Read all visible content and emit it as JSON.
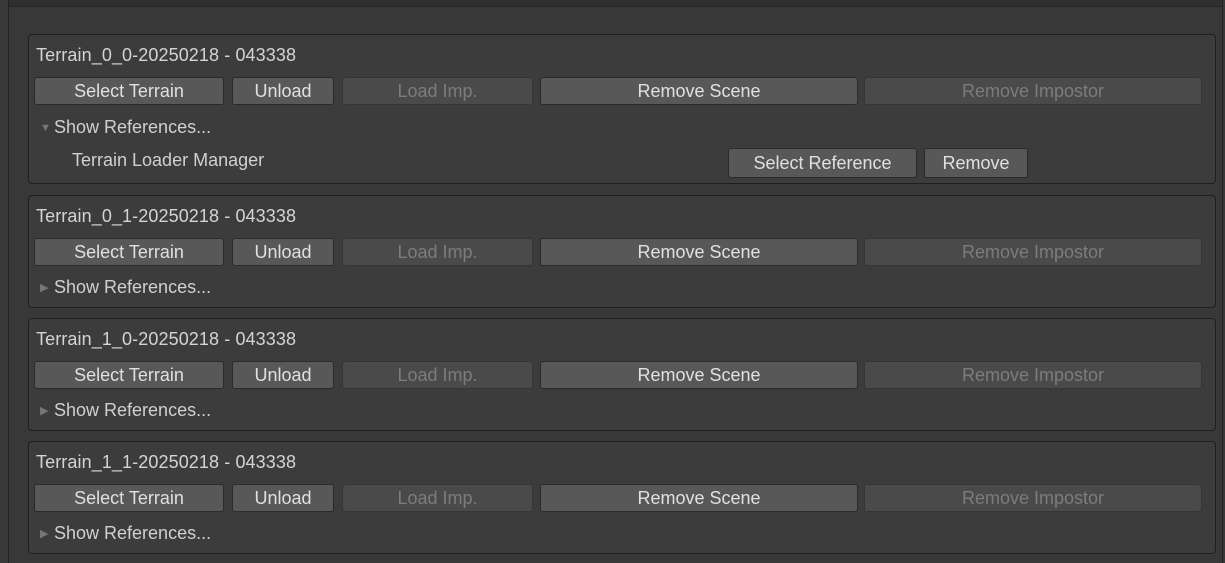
{
  "panels": [
    {
      "title": "Terrain_0_0-20250218 - 043338",
      "buttons": {
        "select_terrain": "Select Terrain",
        "unload": "Unload",
        "load_imp": "Load Imp.",
        "remove_scene": "Remove Scene",
        "remove_impostor": "Remove Impostor"
      },
      "foldout": {
        "label": "Show References...",
        "expanded": true,
        "icon": "triangle-down-icon"
      },
      "references": [
        {
          "name": "Terrain Loader Manager",
          "select_label": "Select Reference",
          "remove_label": "Remove"
        }
      ]
    },
    {
      "title": "Terrain_0_1-20250218 - 043338",
      "buttons": {
        "select_terrain": "Select Terrain",
        "unload": "Unload",
        "load_imp": "Load Imp.",
        "remove_scene": "Remove Scene",
        "remove_impostor": "Remove Impostor"
      },
      "foldout": {
        "label": "Show References...",
        "expanded": false,
        "icon": "triangle-right-icon"
      }
    },
    {
      "title": "Terrain_1_0-20250218 - 043338",
      "buttons": {
        "select_terrain": "Select Terrain",
        "unload": "Unload",
        "load_imp": "Load Imp.",
        "remove_scene": "Remove Scene",
        "remove_impostor": "Remove Impostor"
      },
      "foldout": {
        "label": "Show References...",
        "expanded": false,
        "icon": "triangle-right-icon"
      }
    },
    {
      "title": "Terrain_1_1-20250218 - 043338",
      "buttons": {
        "select_terrain": "Select Terrain",
        "unload": "Unload",
        "load_imp": "Load Imp.",
        "remove_scene": "Remove Scene",
        "remove_impostor": "Remove Impostor"
      },
      "foldout": {
        "label": "Show References...",
        "expanded": false,
        "icon": "triangle-right-icon"
      }
    }
  ],
  "colors": {
    "background": "#383838",
    "panel": "#3c3c3c",
    "button": "#585858",
    "button_disabled": "#4a4a4a",
    "text": "#d2d2d2",
    "text_disabled": "#7c7c7c"
  }
}
